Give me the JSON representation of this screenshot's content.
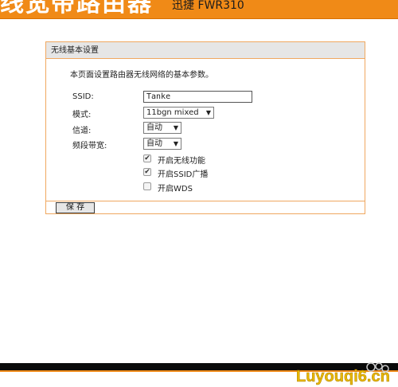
{
  "header": {
    "title": "线宽带路由器",
    "model": "迅捷 FWR310"
  },
  "panel": {
    "title": "无线基本设置",
    "description": "本页面设置路由器无线网络的基本参数。"
  },
  "form": {
    "ssid_label": "SSID:",
    "ssid_value": "Tanke",
    "mode_label": "模式:",
    "mode_value": "11bgn mixed",
    "channel_label": "信道:",
    "channel_value": "自动",
    "bandwidth_label": "频段带宽:",
    "bandwidth_value": "自动"
  },
  "options": [
    {
      "label": "开启无线功能",
      "checked": true
    },
    {
      "label": "开启SSID广播",
      "checked": true
    },
    {
      "label": "开启WDS",
      "checked": false
    }
  ],
  "actions": {
    "save_label": "保 存"
  },
  "watermark": {
    "text": "Luyouqi6.cn"
  },
  "colors": {
    "accent": "#f08a17",
    "panel_border": "#f0a860",
    "panel_header": "#e6e6e6"
  }
}
